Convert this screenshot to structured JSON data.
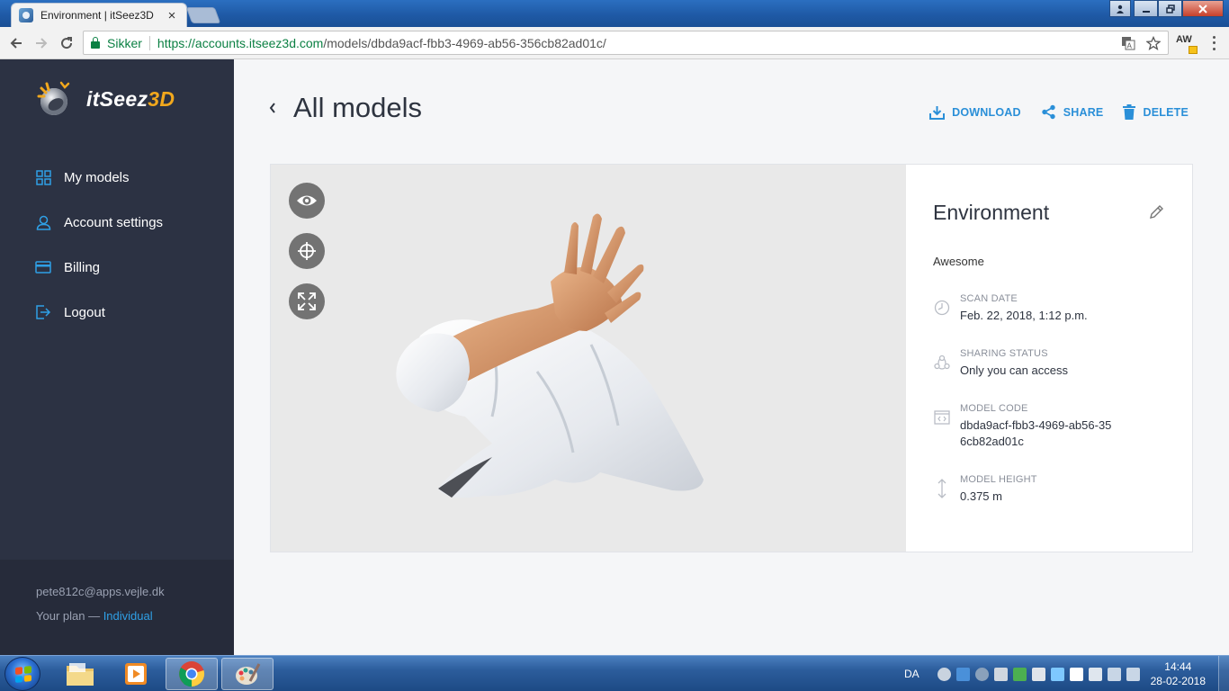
{
  "browser": {
    "tab_title": "Environment | itSeez3D",
    "tab_close": "×",
    "secure_label": "Sikker",
    "url_host": "https://accounts.itseez3d.com",
    "url_path": "/models/dbda9acf-fbb3-4969-ab56-356cb82ad01c/",
    "extension_label": "AW"
  },
  "sidebar": {
    "logo_text_main": "itSeez",
    "logo_text_accent": "3D",
    "items": [
      {
        "label": "My models",
        "icon": "grid-icon"
      },
      {
        "label": "Account settings",
        "icon": "user-icon"
      },
      {
        "label": "Billing",
        "icon": "card-icon"
      },
      {
        "label": "Logout",
        "icon": "logout-icon"
      }
    ],
    "email": "pete812c@apps.vejle.dk",
    "plan_prefix": "Your plan — ",
    "plan_name": "Individual"
  },
  "header": {
    "title": "All models",
    "actions": {
      "download": "DOWNLOAD",
      "share": "SHARE",
      "delete": "DELETE"
    }
  },
  "model": {
    "name": "Environment",
    "description": "Awesome",
    "meta": [
      {
        "key": "SCAN DATE",
        "value": "Feb. 22, 2018, 1:12 p.m.",
        "icon": "clock-icon"
      },
      {
        "key": "SHARING STATUS",
        "value": "Only you can access",
        "icon": "share-status-icon"
      },
      {
        "key": "MODEL CODE",
        "value": "dbda9acf-fbb3-4969-ab56-356cb82ad01c",
        "icon": "code-icon"
      },
      {
        "key": "MODEL HEIGHT",
        "value": "0.375 m",
        "icon": "height-icon"
      }
    ]
  },
  "viewer": {
    "buttons": [
      "eye-icon",
      "move-icon",
      "expand-icon"
    ]
  },
  "taskbar": {
    "language": "DA",
    "time": "14:44",
    "date": "28-02-2018"
  },
  "colors": {
    "accent": "#2a8fd8",
    "sidebar": "#2c3243",
    "logo_accent": "#f2a81d"
  }
}
